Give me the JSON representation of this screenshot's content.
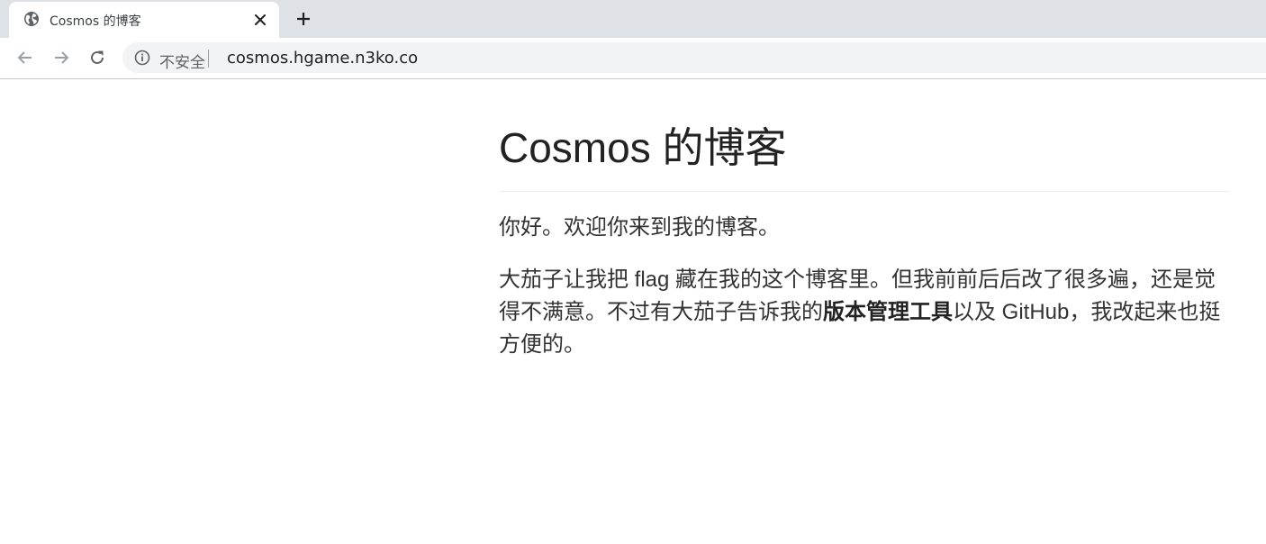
{
  "browser": {
    "tab": {
      "title": "Cosmos 的博客",
      "favicon": "globe-icon",
      "close_icon": "close-icon"
    },
    "new_tab_icon": "plus-icon",
    "nav": {
      "back_icon": "arrow-left-icon",
      "forward_icon": "arrow-right-icon",
      "reload_icon": "reload-icon"
    },
    "omnibox": {
      "security_icon": "info-icon",
      "security_label": "不安全",
      "url": "cosmos.hgame.n3ko.co"
    }
  },
  "page": {
    "title": "Cosmos 的博客",
    "greeting": "你好。欢迎你来到我的博客。",
    "body": {
      "part1": "大茄子让我把 flag 藏在我的这个博客里。但我前前后后改了很多遍，还是觉得不满意。不过有大茄子告诉我的",
      "emphasis": "版本管理工具",
      "part2": "以及 GitHub，我改起来也挺方便的。"
    }
  },
  "colors": {
    "tabstrip_bg": "#dee1e6",
    "omnibox_bg": "#f1f3f4",
    "text": "#333333"
  }
}
